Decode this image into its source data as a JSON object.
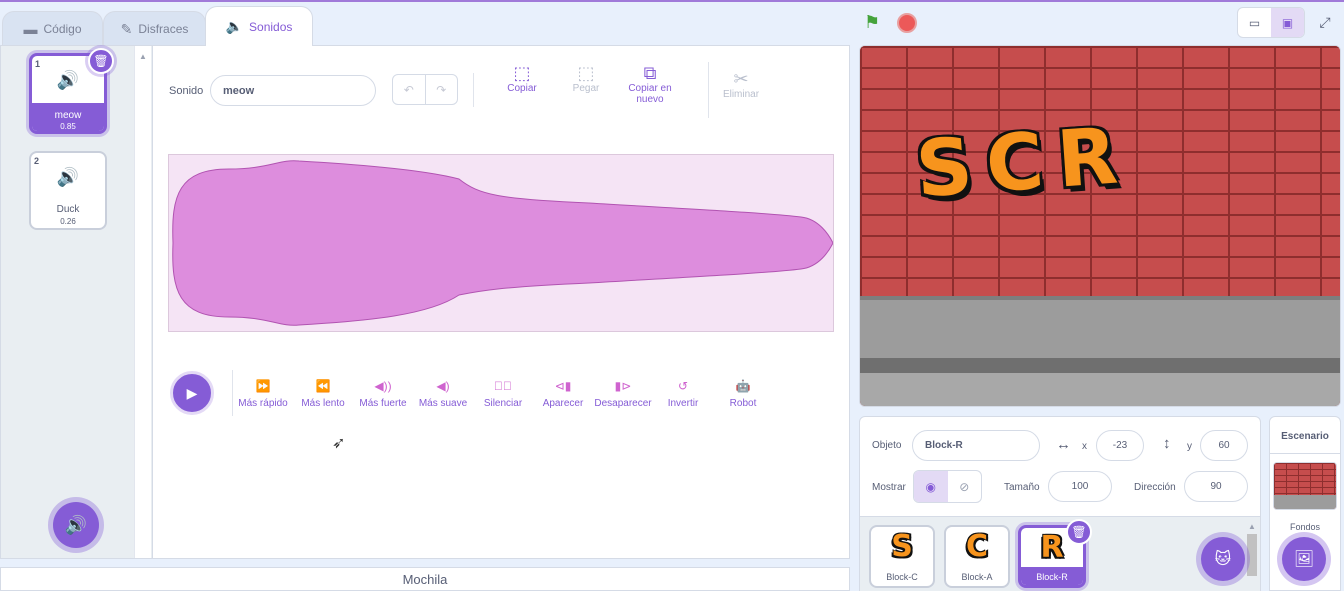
{
  "tabs": [
    {
      "label": "Código",
      "icon": "code-blocks-icon"
    },
    {
      "label": "Disfraces",
      "icon": "brush-icon"
    },
    {
      "label": "Sonidos",
      "icon": "speaker-icon"
    }
  ],
  "sound_list": [
    {
      "index": "1",
      "name": "meow",
      "duration": "0.85",
      "selected": true
    },
    {
      "index": "2",
      "name": "Duck",
      "duration": "0.26",
      "selected": false
    }
  ],
  "editor": {
    "name_label": "Sonido",
    "name_value": "meow",
    "tools": {
      "copy": "Copiar",
      "paste": "Pegar",
      "copy_new": "Copiar en nuevo",
      "delete": "Eliminar"
    }
  },
  "effects": [
    "Más rápido",
    "Más lento",
    "Más fuerte",
    "Más suave",
    "Silenciar",
    "Aparecer",
    "Desaparecer",
    "Invertir",
    "Robot"
  ],
  "backpack": "Mochila",
  "stage_text": "SCR",
  "sprite_info": {
    "sprite_label": "Objeto",
    "sprite_name": "Block-R",
    "x_label": "x",
    "x_value": "-23",
    "y_label": "y",
    "y_value": "60",
    "show_label": "Mostrar",
    "size_label": "Tamaño",
    "size_value": "100",
    "direction_label": "Dirección",
    "direction_value": "90"
  },
  "sprites": [
    {
      "letter": "S",
      "name": "Block-C"
    },
    {
      "letter": "C",
      "name": "Block-A"
    },
    {
      "letter": "R",
      "name": "Block-R",
      "selected": true
    }
  ],
  "stage_panel": {
    "title": "Escenario",
    "backdrops_label": "Fondos"
  },
  "colors": {
    "accent": "#855cd6",
    "sound_effect": "#cf63cf",
    "waveform_fill": "#dd8ddd",
    "waveform_bg": "#f5e4f5",
    "stage_text": "#f7941d"
  }
}
